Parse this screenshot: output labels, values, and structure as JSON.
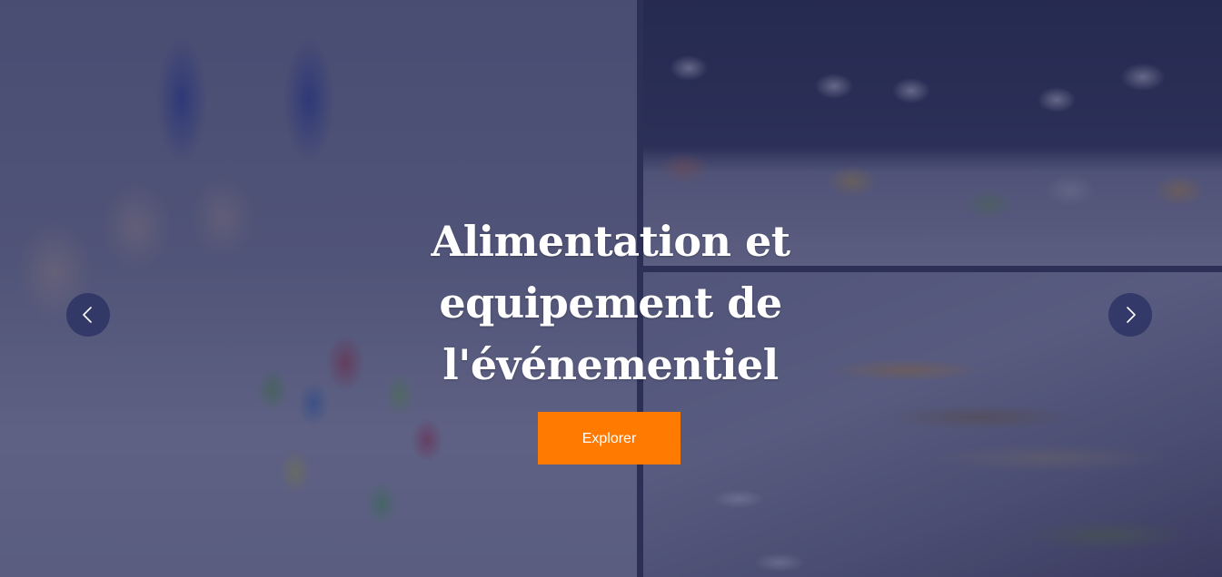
{
  "hero": {
    "title": "Alimentation et equipement de l'événementiel",
    "cta_label": "Explorer"
  },
  "carousel": {
    "prev_icon": "chevron-left-icon",
    "next_icon": "chevron-right-icon"
  },
  "colors": {
    "accent": "#ff7a00",
    "overlay": "#202452",
    "arrow_background": "#2d3464"
  }
}
